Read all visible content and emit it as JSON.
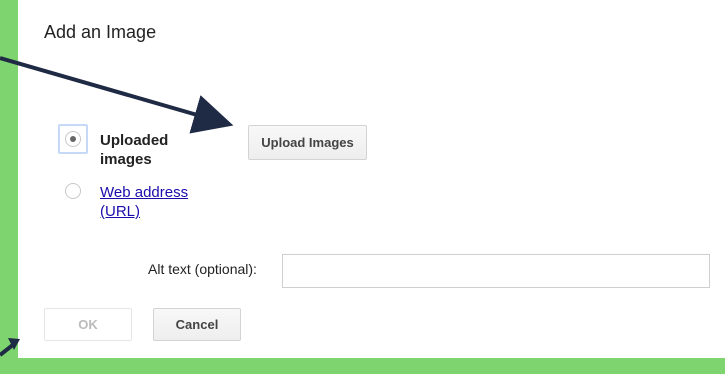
{
  "dialog": {
    "title": "Add an Image",
    "options": [
      {
        "label": "Uploaded images",
        "selected": true
      },
      {
        "label": "Web address (URL)",
        "selected": false
      }
    ],
    "upload_button": "Upload Images",
    "alt_text_label": "Alt text (optional):",
    "alt_text_value": "",
    "ok_button": "OK",
    "cancel_button": "Cancel"
  },
  "colors": {
    "background": "#7ed56f",
    "link": "#1a0dab",
    "arrow": "#1f2a44"
  }
}
